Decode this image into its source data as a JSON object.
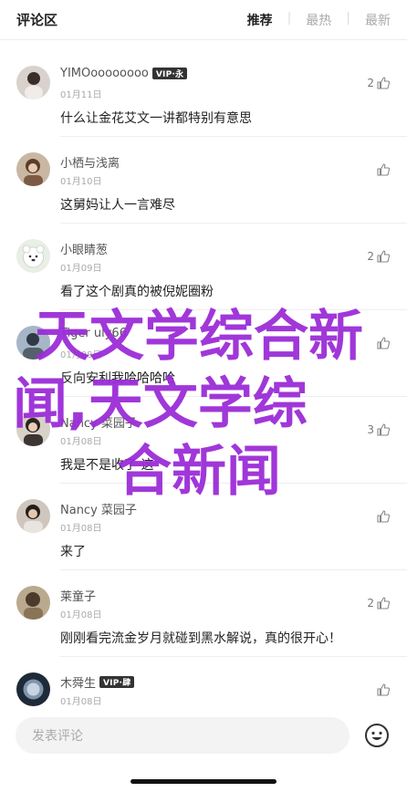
{
  "header": {
    "title": "评论区",
    "tabs": [
      {
        "label": "推荐",
        "active": true
      },
      {
        "label": "最热",
        "active": false
      },
      {
        "label": "最新",
        "active": false
      }
    ]
  },
  "comments": [
    {
      "name": "YIMOoooooooo",
      "vip": "VIP·永",
      "date": "01月11日",
      "text": "什么让金花艾文一讲都特别有意思",
      "likes": "2"
    },
    {
      "name": "小栖与浅离",
      "vip": "",
      "date": "01月10日",
      "text": "这舅妈让人一言难尽",
      "likes": ""
    },
    {
      "name": "小眼睛葱",
      "vip": "",
      "date": "01月09日",
      "text": "看了这个剧真的被倪妮圈粉",
      "likes": "2"
    },
    {
      "name": "Tiger   uly66",
      "vip": "",
      "date": "01月08日",
      "text": "反向安利我哈哈哈哈",
      "likes": ""
    },
    {
      "name": "Nancy 菜园子",
      "vip": "",
      "date": "01月08日",
      "text": "我是不是收了 这",
      "likes": "3"
    },
    {
      "name": "Nancy 菜园子",
      "vip": "",
      "date": "01月08日",
      "text": "来了",
      "likes": ""
    },
    {
      "name": "莱童子",
      "vip": "",
      "date": "01月08日",
      "text": "刚刚看完流金岁月就碰到黑水解说，真的很开心！",
      "likes": "2"
    },
    {
      "name": "木舜生",
      "vip": "VIP·肆",
      "date": "01月08日",
      "text": "",
      "likes": ""
    }
  ],
  "watermark": {
    "line1": "天文学综合新",
    "line2": "闻,天文学综",
    "line3": "合新闻"
  },
  "composer": {
    "placeholder": "发表评论"
  },
  "icons": {
    "like": "thumbs-up-icon",
    "emoji": "emoji-icon"
  },
  "colors": {
    "watermark": "#9b2dd7",
    "text": "#222222",
    "muted": "#aaaaaa"
  }
}
